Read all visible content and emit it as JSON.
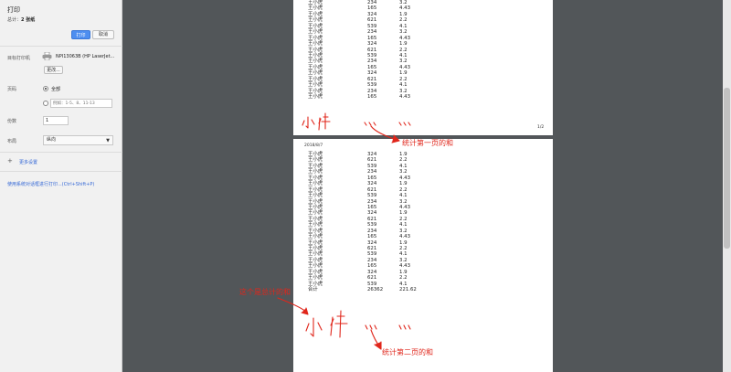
{
  "sidebar": {
    "title": "打印",
    "total_label": "总计：",
    "total_value": "2 张纸",
    "print_button": "打印",
    "cancel_button": "取消",
    "destination_label": "目标打印机",
    "printer_name": "NPI13063B (HP LaserJet...",
    "change_button": "更改...",
    "pages_label": "页码",
    "pages_all": "全部",
    "pages_placeholder": "例如：1-5、8、11-13",
    "copies_label": "份数",
    "copies_value": "1",
    "layout_label": "布局",
    "layout_value": "纵向",
    "more_settings": "更多设置",
    "system_dialog_link": "使用系统对话框进行打印...(Ctrl+Shift+P)"
  },
  "preview": {
    "page1_number": "1/2",
    "page2_date": "2018/8/7",
    "page1_rows": [
      [
        "王小虎",
        "234",
        "3.2"
      ],
      [
        "王小虎",
        "165",
        "4.43"
      ],
      [
        "王小虎",
        "324",
        "1.9"
      ],
      [
        "王小虎",
        "621",
        "2.2"
      ],
      [
        "王小虎",
        "539",
        "4.1"
      ],
      [
        "王小虎",
        "234",
        "3.2"
      ],
      [
        "王小虎",
        "165",
        "4.43"
      ],
      [
        "王小虎",
        "324",
        "1.9"
      ],
      [
        "王小虎",
        "621",
        "2.2"
      ],
      [
        "王小虎",
        "539",
        "4.1"
      ],
      [
        "王小虎",
        "234",
        "3.2"
      ],
      [
        "王小虎",
        "165",
        "4.43"
      ],
      [
        "王小虎",
        "324",
        "1.9"
      ],
      [
        "王小虎",
        "621",
        "2.2"
      ],
      [
        "王小虎",
        "539",
        "4.1"
      ],
      [
        "王小虎",
        "234",
        "3.2"
      ],
      [
        "王小虎",
        "165",
        "4.43"
      ]
    ],
    "page2_rows": [
      [
        "王小虎",
        "324",
        "1.9"
      ],
      [
        "王小虎",
        "621",
        "2.2"
      ],
      [
        "王小虎",
        "539",
        "4.1"
      ],
      [
        "王小虎",
        "234",
        "3.2"
      ],
      [
        "王小虎",
        "165",
        "4.43"
      ],
      [
        "王小虎",
        "324",
        "1.9"
      ],
      [
        "王小虎",
        "621",
        "2.2"
      ],
      [
        "王小虎",
        "539",
        "4.1"
      ],
      [
        "王小虎",
        "234",
        "3.2"
      ],
      [
        "王小虎",
        "165",
        "4.43"
      ],
      [
        "王小虎",
        "324",
        "1.9"
      ],
      [
        "王小虎",
        "621",
        "2.2"
      ],
      [
        "王小虎",
        "539",
        "4.1"
      ],
      [
        "王小虎",
        "234",
        "3.2"
      ],
      [
        "王小虎",
        "165",
        "4.43"
      ],
      [
        "王小虎",
        "324",
        "1.9"
      ],
      [
        "王小虎",
        "621",
        "2.2"
      ],
      [
        "王小虎",
        "539",
        "4.1"
      ],
      [
        "王小虎",
        "234",
        "3.2"
      ],
      [
        "王小虎",
        "165",
        "4.43"
      ],
      [
        "王小虎",
        "324",
        "1.9"
      ],
      [
        "王小虎",
        "621",
        "2.2"
      ],
      [
        "王小虎",
        "539",
        "4.1"
      ],
      [
        "合计",
        "26362",
        "221.62"
      ]
    ]
  },
  "annotations": {
    "page1_sum": "统计第一页的和",
    "page2_note": "这个是总计的和",
    "page2_sum": "统计第二页的和",
    "handwritten_subtotal": "小计"
  },
  "colors": {
    "accent": "#4d8ef0",
    "annotation": "#e0261b"
  }
}
